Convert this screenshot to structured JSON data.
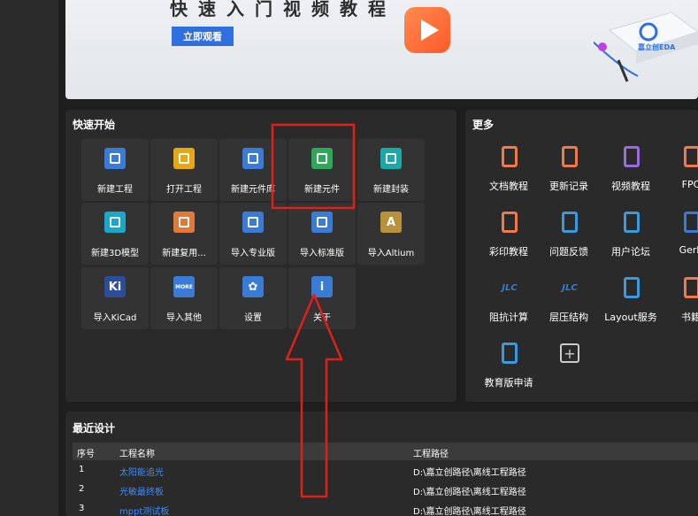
{
  "banner": {
    "title": "快速入门视频教程",
    "button_label": "立即观看",
    "logo_text": "嘉立创EDA"
  },
  "quick_start": {
    "title": "快速开始",
    "items": [
      {
        "label": "新建工程",
        "icon": "new-project-icon",
        "color": "#3a7bd5"
      },
      {
        "label": "打开工程",
        "icon": "open-folder-icon",
        "color": "#e6a817"
      },
      {
        "label": "新建元件库",
        "icon": "new-library-icon",
        "color": "#3a7bd5"
      },
      {
        "label": "新建元件",
        "icon": "new-component-icon",
        "color": "#2fa85a"
      },
      {
        "label": "新建封装",
        "icon": "new-footprint-icon",
        "color": "#1aa8a8"
      },
      {
        "label": "新建3D模型",
        "icon": "new-3d-model-icon",
        "color": "#1aa8c8"
      },
      {
        "label": "新建复用...",
        "icon": "new-reuse-block-icon",
        "color": "#e07a3a"
      },
      {
        "label": "导入专业版",
        "icon": "import-pro-icon",
        "color": "#3a7bd5"
      },
      {
        "label": "导入标准版",
        "icon": "import-standard-icon",
        "color": "#3a7bd5"
      },
      {
        "label": "导入Altium",
        "icon": "altium-icon",
        "color": "#b8923a",
        "glyph": "A"
      },
      {
        "label": "导入KiCad",
        "icon": "kicad-icon",
        "color": "#2b4d9a",
        "glyph": "Ki"
      },
      {
        "label": "导入其他",
        "icon": "import-more-icon",
        "color": "#3a7bd5",
        "glyph": "MORE"
      },
      {
        "label": "设置",
        "icon": "gear-icon",
        "color": "#3a7bd5",
        "glyph": "✿"
      },
      {
        "label": "关于",
        "icon": "info-icon",
        "color": "#3a7bd5",
        "glyph": "i"
      }
    ]
  },
  "more": {
    "title": "更多",
    "items": [
      {
        "label": "文档教程",
        "icon": "document-icon",
        "color": "#f07a4a"
      },
      {
        "label": "更新记录",
        "icon": "changelog-icon",
        "color": "#f07a4a"
      },
      {
        "label": "视频教程",
        "icon": "video-icon",
        "color": "#9a6be0"
      },
      {
        "label": "FPC",
        "icon": "fpc-icon",
        "color": "#f07a4a"
      },
      {
        "label": "彩印教程",
        "icon": "color-print-icon",
        "color": "#f07a4a"
      },
      {
        "label": "问题反馈",
        "icon": "feedback-icon",
        "color": "#3a9ae0"
      },
      {
        "label": "用户论坛",
        "icon": "forum-icon",
        "color": "#3a9ae0"
      },
      {
        "label": "Gerb",
        "icon": "gerber-icon",
        "color": "#3a7bd5"
      },
      {
        "label": "阻抗计算",
        "icon": "impedance-icon",
        "color": "#3a7bd5",
        "glyph": "JLC"
      },
      {
        "label": "层压结构",
        "icon": "stackup-icon",
        "color": "#3a7bd5",
        "glyph": "JLC"
      },
      {
        "label": "Layout服务",
        "icon": "layout-service-icon",
        "color": "#3a9ae0"
      },
      {
        "label": "书籍",
        "icon": "book-icon",
        "color": "#f07a4a"
      },
      {
        "label": "教育版申请",
        "icon": "education-icon",
        "color": "#3a9ae0"
      },
      {
        "label": "",
        "icon": "add-icon",
        "color": "#cccccc",
        "glyph": "+"
      }
    ]
  },
  "recent": {
    "title": "最近设计",
    "headers": {
      "index": "序号",
      "name": "工程名称",
      "path": "工程路径"
    },
    "rows": [
      {
        "index": "1",
        "name": "太阳能追光",
        "path": "D:\\嘉立创路径\\离线工程路径"
      },
      {
        "index": "2",
        "name": "光敏最终板",
        "path": "D:\\嘉立创路径\\离线工程路径"
      },
      {
        "index": "3",
        "name": "mppt测试板",
        "path": "D:\\嘉立创路径\\离线工程路径"
      }
    ]
  },
  "colors": {
    "annotation": "#e0201a",
    "link": "#3b8cff",
    "panel": "#2a2a2a"
  }
}
